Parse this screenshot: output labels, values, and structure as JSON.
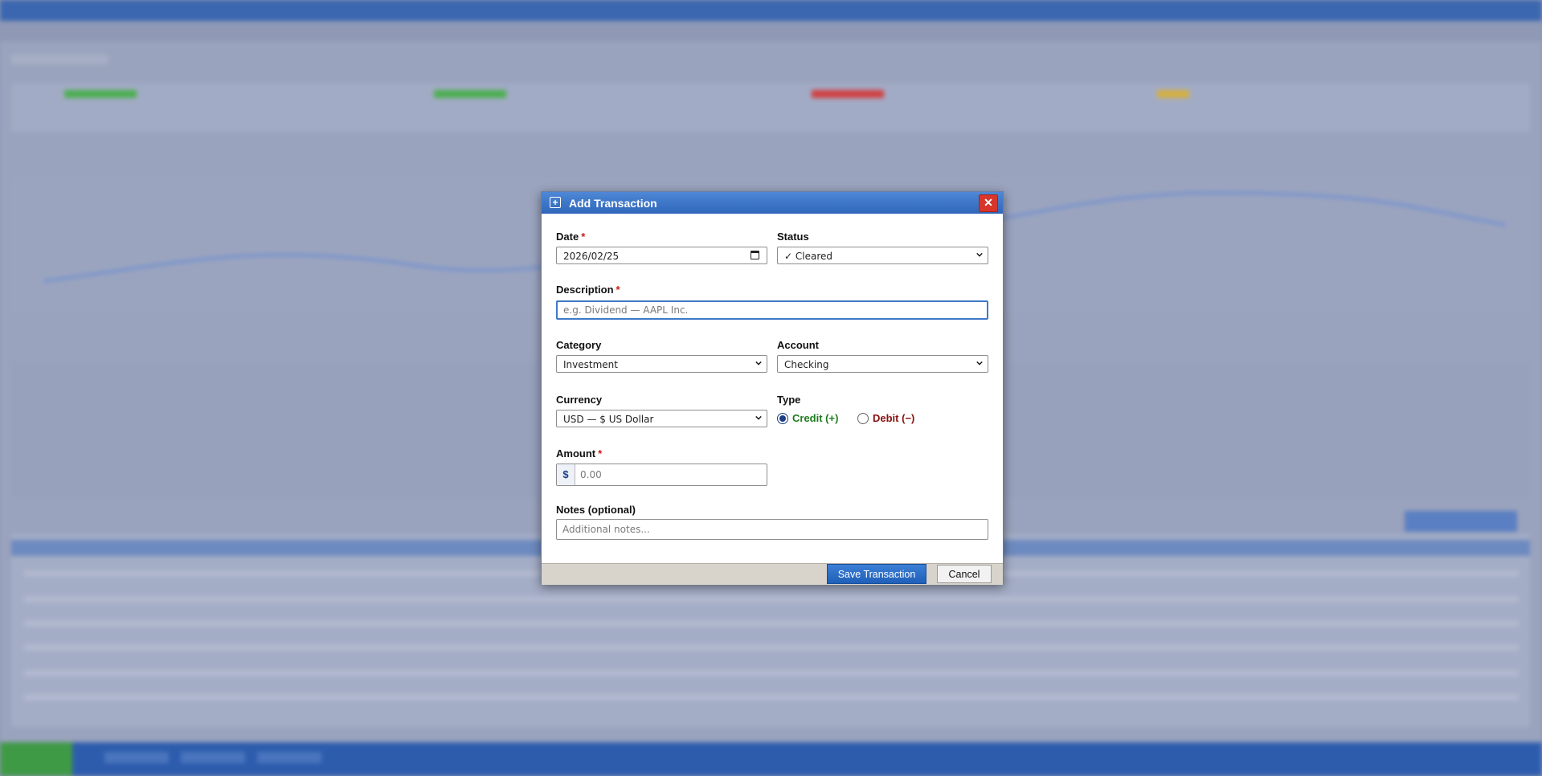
{
  "dialog": {
    "title": "Add Transaction",
    "title_icon": "plus-square-icon",
    "close_label": "✕",
    "date": {
      "label": "Date",
      "required": "*",
      "value": "2026/02/25"
    },
    "status": {
      "label": "Status",
      "value": "✓ Cleared"
    },
    "description": {
      "label": "Description",
      "required": "*",
      "placeholder": "e.g. Dividend — AAPL Inc."
    },
    "category": {
      "label": "Category",
      "value": "Investment"
    },
    "account": {
      "label": "Account",
      "value": "Checking"
    },
    "currency": {
      "label": "Currency",
      "value": "USD — $ US Dollar"
    },
    "type": {
      "label": "Type",
      "credit_label": "Credit (+)",
      "debit_label": "Debit (−)",
      "selected": "credit",
      "credit_color": "#1e7a1e",
      "debit_color": "#8a1010"
    },
    "amount": {
      "label": "Amount",
      "required": "*",
      "prefix": "$",
      "placeholder": "0.00"
    },
    "notes": {
      "label": "Notes (optional)",
      "placeholder": "Additional notes..."
    },
    "buttons": {
      "save": "Save Transaction",
      "cancel": "Cancel"
    }
  },
  "colors": {
    "accent": "#2f66bb",
    "close": "#d9362b",
    "required": "#d01818"
  }
}
